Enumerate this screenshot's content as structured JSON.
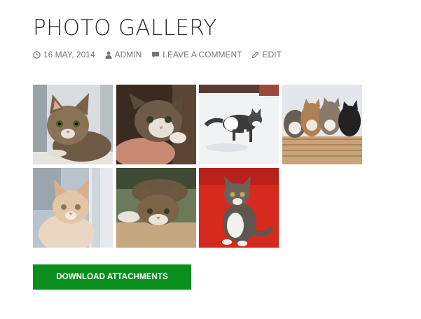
{
  "post": {
    "title": "PHOTO GALLERY",
    "meta": {
      "date": "16 MAY, 2014",
      "author": "ADMIN",
      "comment_link": "LEAVE A COMMENT",
      "edit_link": "EDIT"
    }
  },
  "gallery": {
    "images": [
      {
        "subject": "tabby kitten on windowsill",
        "icon": "kitten-photo"
      },
      {
        "subject": "tabby kitten held in hand",
        "icon": "kitten-photo"
      },
      {
        "subject": "kitten walking in snow",
        "icon": "kitten-photo"
      },
      {
        "subject": "four kittens in a basket",
        "icon": "kitten-photo"
      },
      {
        "subject": "ginger and white kitten",
        "icon": "kitten-photo"
      },
      {
        "subject": "tabby kitten crouching",
        "icon": "kitten-photo"
      },
      {
        "subject": "kitten on red background",
        "icon": "kitten-photo"
      }
    ]
  },
  "actions": {
    "download_label": "DOWNLOAD ATTACHMENTS"
  },
  "colors": {
    "button_bg": "#0a8f1f",
    "meta_text": "#767676",
    "title_text": "#2b2b2b"
  }
}
